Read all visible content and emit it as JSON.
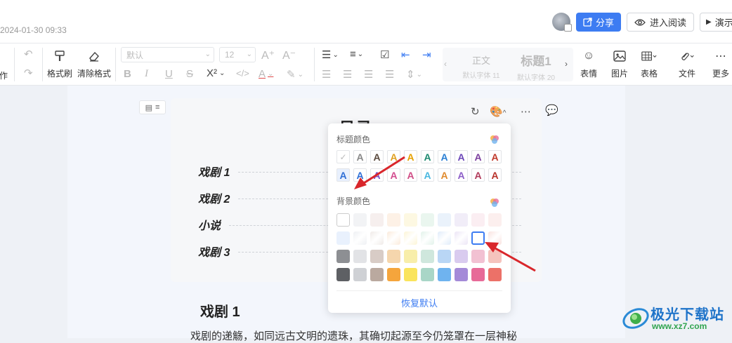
{
  "header": {
    "date": "2024-01-30 09:33",
    "share_label": "分享",
    "read_label": "进入阅读",
    "present_label": "演示"
  },
  "toolbar": {
    "partial_left_label": "作",
    "format_painter_label": "格式刷",
    "clear_format_label": "清除格式",
    "font_family_value": "默认",
    "font_size_value": "12",
    "style_body_label": "正文",
    "style_body_sub": "默认字体 11",
    "style_h1_label": "标题1",
    "style_h1_sub": "默认字体 20",
    "emoji_label": "表情",
    "image_label": "图片",
    "table_label": "表格",
    "file_label": "文件",
    "more_label": "更多"
  },
  "doc": {
    "toc_title_fragment": "目录",
    "toc_items": [
      "戏剧 1",
      "戏剧 2",
      "小说",
      "戏剧 3"
    ],
    "heading": "戏剧 1",
    "body_text": "戏剧的递觞，如同远古文明的遗珠，其确切起源至今仍笼罩在一层神秘"
  },
  "popup": {
    "title_color_label": "标题颜色",
    "bg_color_label": "背景颜色",
    "reset_label": "恢复默认",
    "letter_glyph": "A",
    "title_colors_row1": [
      "#888888",
      "#5a4a3e",
      "#e0a020",
      "#e6a100",
      "#1f8a70",
      "#2a7fd4",
      "#6b46b8",
      "#7b3f9e",
      "#c0392b"
    ],
    "title_colors_row2": [
      "#2f6fd6",
      "#2f6fd6",
      "#7a52c7",
      "#d34d8f",
      "#d04e86",
      "#4ab8e0",
      "#e08b2e",
      "#8c5ec8",
      "#b03a5b",
      "#b8322a"
    ],
    "bg_row1": [
      "#ffffff",
      "#f2f3f5",
      "#f6efee",
      "#fdf1e6",
      "#fdf8e2",
      "#eaf6ef",
      "#eaf2fb",
      "#f1edf8",
      "#fbeef2",
      "#fcefee"
    ],
    "bg_row2": [
      "#e9f1fd",
      "#eef0f3",
      "#f0ebe8",
      "#fbebdc",
      "#fcf5d6",
      "#e2f2ea",
      "#e0ecfa",
      "#ece5f6",
      "#f7e3ea",
      "#f9e3e0"
    ],
    "bg_row3": [
      "#8d8f93",
      "#e2e3e6",
      "#d8ccc6",
      "#f5d6ad",
      "#f8eeaa",
      "#cfe7dd",
      "#b9d6f5",
      "#d9cbef",
      "#f2c1d2",
      "#f5c3bd"
    ],
    "bg_row4": [
      "#5e6064",
      "#cfd1d5",
      "#baa99f",
      "#f5a53c",
      "#fae45c",
      "#a9d6c7",
      "#6fb3ef",
      "#a48ad8",
      "#e76a98",
      "#ec7168"
    ]
  },
  "watermark": {
    "name": "极光下载站",
    "url": "www.xz7.com"
  }
}
